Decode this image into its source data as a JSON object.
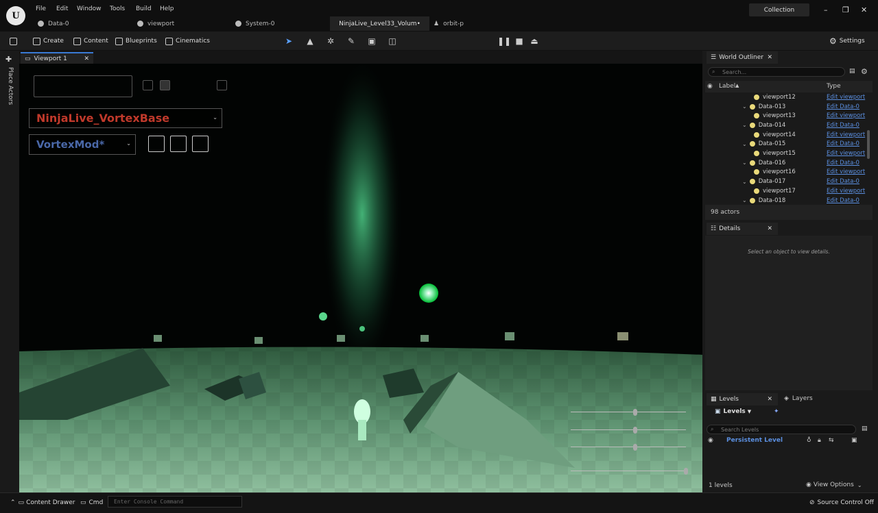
{
  "menu": [
    "File",
    "Edit",
    "Window",
    "Tools",
    "Build",
    "Help"
  ],
  "tabs": [
    "Data-0",
    "viewport",
    "System-0",
    "NinjaLive_Level33_Volum•",
    "orbit-p"
  ],
  "collection_label": "Collection",
  "toolbar": {
    "create": "Create",
    "content": "Content",
    "blueprints": "Blueprints",
    "cinematics": "Cinematics",
    "settings": "Settings"
  },
  "left_strip": {
    "place_actors": "Place Actors"
  },
  "viewport": {
    "tab": "Viewport 1",
    "select_main": "NinjaLive_VortexBase",
    "select_mod": "VortexMod*",
    "sliders": [
      0.55,
      0.55,
      0.55,
      1.0
    ]
  },
  "outliner": {
    "title": "World Outliner",
    "search_placeholder": "Search...",
    "col_label": "Label",
    "col_type": "Type",
    "rows": [
      {
        "label": "viewport12",
        "type": "Edit viewport",
        "kind": "child"
      },
      {
        "label": "Data-013",
        "type": "Edit Data-0",
        "kind": "parent"
      },
      {
        "label": "viewport13",
        "type": "Edit viewport",
        "kind": "child"
      },
      {
        "label": "Data-014",
        "type": "Edit Data-0",
        "kind": "parent"
      },
      {
        "label": "viewport14",
        "type": "Edit viewport",
        "kind": "child"
      },
      {
        "label": "Data-015",
        "type": "Edit Data-0",
        "kind": "parent"
      },
      {
        "label": "viewport15",
        "type": "Edit viewport",
        "kind": "child"
      },
      {
        "label": "Data-016",
        "type": "Edit Data-0",
        "kind": "parent"
      },
      {
        "label": "viewport16",
        "type": "Edit viewport",
        "kind": "child"
      },
      {
        "label": "Data-017",
        "type": "Edit Data-0",
        "kind": "parent"
      },
      {
        "label": "viewport17",
        "type": "Edit viewport",
        "kind": "child"
      },
      {
        "label": "Data-018",
        "type": "Edit Data-0",
        "kind": "parent"
      }
    ],
    "actor_count": "98 actors"
  },
  "details": {
    "title": "Details",
    "empty": "Select an object to view details."
  },
  "levels": {
    "tab": "Levels",
    "layers_tab": "Layers",
    "dropdown": "Levels",
    "search_placeholder": "Search Levels",
    "persistent": "Persistent Level",
    "count": "1 levels",
    "view_options": "View Options"
  },
  "status": {
    "content_drawer": "Content Drawer",
    "cmd": "Cmd",
    "console_placeholder": "Enter Console Command",
    "source_control": "Source Control Off"
  },
  "colors": {
    "accent": "#3a7bd5",
    "link": "#5b8fe0",
    "select_main": "#c0392b",
    "select_mod": "#4a68a8"
  }
}
